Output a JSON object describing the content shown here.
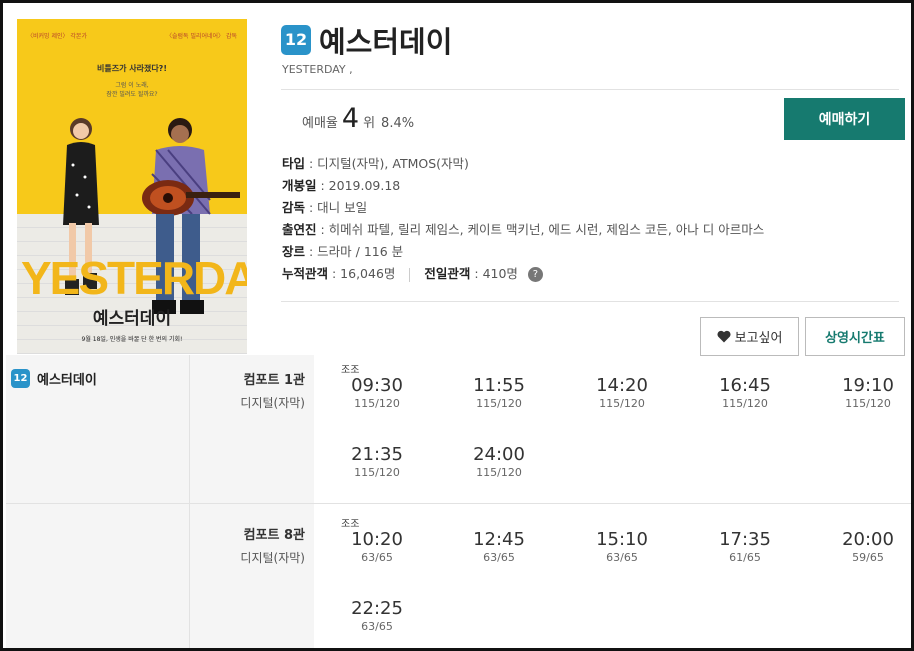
{
  "poster": {
    "credits_left": "〈비커밍 제인〉 각본가",
    "credits_right": "〈슬럼독 밀리어네어〉 감독",
    "tagline": "비틀즈가 사라졌다?!",
    "tagline2_a": "그럼 이 노래,",
    "tagline2_b": "잠깐 빌려도 될까요?",
    "big_title": "YESTERDAY",
    "kr_title": "예스터데이",
    "release": "9월 18일, 인생을 바꿀 단 한 번의 기회!"
  },
  "movie": {
    "rating": "12",
    "title": "예스터데이",
    "en_title": "YESTERDAY ,"
  },
  "ranking": {
    "label": "예매율",
    "rank": "4",
    "unit": "위",
    "percent": "8.4%"
  },
  "book_button": "예매하기",
  "info": {
    "type_label": "타입",
    "type_value": " : 디지털(자막), ATMOS(자막)",
    "open_label": "개봉일",
    "open_value": " : 2019.09.18",
    "director_label": "감독",
    "director_value": " : 대니 보일",
    "cast_label": "출연진",
    "cast_value": " : 히메쉬 파텔, 릴리 제임스, 케이트 맥키넌, 에드 시런, 제임스 코든, 아나 디 아르마스",
    "genre_label": "장르",
    "genre_value": " : 드라마 / 116 분",
    "total_label": "누적관객",
    "total_value": " : 16,046명",
    "prev_label": "전일관객",
    "prev_value": " : 410명",
    "help_icon_text": "?"
  },
  "buttons": {
    "wish": "보고싶어",
    "schedule": "상영시간표"
  },
  "schedule": {
    "movie_rating": "12",
    "movie_name": "예스터데이",
    "halls": [
      {
        "name": "컴포트 1관",
        "type": "디지털(자막)",
        "slots": [
          {
            "tag": "조조",
            "time": "09:30",
            "seats": "115/120"
          },
          {
            "tag": "",
            "time": "11:55",
            "seats": "115/120"
          },
          {
            "tag": "",
            "time": "14:20",
            "seats": "115/120"
          },
          {
            "tag": "",
            "time": "16:45",
            "seats": "115/120"
          },
          {
            "tag": "",
            "time": "19:10",
            "seats": "115/120"
          },
          {
            "tag": "",
            "time": "21:35",
            "seats": "115/120"
          },
          {
            "tag": "",
            "time": "24:00",
            "seats": "115/120"
          }
        ]
      },
      {
        "name": "컴포트 8관",
        "type": "디지털(자막)",
        "slots": [
          {
            "tag": "조조",
            "time": "10:20",
            "seats": "63/65"
          },
          {
            "tag": "",
            "time": "12:45",
            "seats": "63/65"
          },
          {
            "tag": "",
            "time": "15:10",
            "seats": "63/65"
          },
          {
            "tag": "",
            "time": "17:35",
            "seats": "61/65"
          },
          {
            "tag": "",
            "time": "20:00",
            "seats": "59/65"
          },
          {
            "tag": "",
            "time": "22:25",
            "seats": "63/65"
          }
        ]
      }
    ]
  },
  "colors": {
    "accent": "#167a6f",
    "rating_badge": "#2a93c9",
    "poster_bg": "#f7c91a"
  }
}
